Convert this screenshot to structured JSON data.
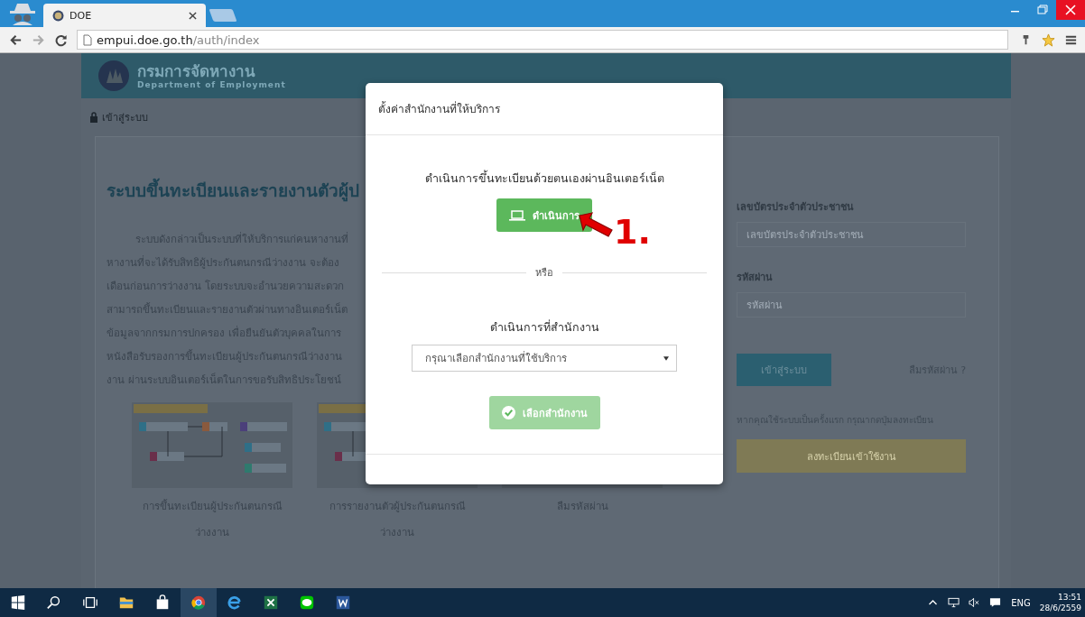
{
  "browser": {
    "tab_title": "DOE",
    "url_host": "empui.doe.go.th",
    "url_path": "/auth/index"
  },
  "site_header": {
    "title": "กรมการจัดหางาน",
    "subtitle": "Department of Employment"
  },
  "breadcrumb": "เข้าสู่ระบบ",
  "intro": {
    "title": "ระบบขึ้นทะเบียนและรายงานตัวผู้ป",
    "lines": [
      "ระบบดังกล่าวเป็นระบบที่ให้บริการแก่คนหางานที่",
      "หางานที่จะได้รับสิทธิผู้ประกันตนกรณีว่างงาน จะต้อง",
      "เดือนก่อนการว่างงาน โดยระบบจะอำนวยความสะดวก",
      "สามารถขึ้นทะเบียนและรายงานตัวผ่านทางอินเตอร์เน็ต",
      "ข้อมูลจากกรมการปกครอง เพื่อยืนยันตัวบุคคลในการ",
      "หนังสือรับรองการขึ้นทะเบียนผู้ประกันตนกรณีว่างงาน",
      "งาน ผ่านระบบอินเตอร์เน็ตในการขอรับสิทธิประโยชน์"
    ]
  },
  "guides": [
    {
      "caption": [
        "การขึ้นทะเบียนผู้ประกันตนกรณี",
        "ว่างงาน"
      ]
    },
    {
      "caption": [
        "การรายงานตัวผู้ประกันตนกรณี",
        "ว่างงาน"
      ]
    },
    {
      "caption": [
        "ลืมรหัสผ่าน"
      ]
    }
  ],
  "login": {
    "id_label": "เลขบัตรประจำตัวประชาชน",
    "id_placeholder": "เลขบัตรประจำตัวประชาชน",
    "password_label": "รหัสผ่าน",
    "password_placeholder": "รหัสผ่าน",
    "login_button": "เข้าสู่ระบบ",
    "forgot_link": "ลืมรหัสผ่าน ?",
    "first_time_note": "หากคุณใช้ระบบเป็นครั้งแรก กรุณากดปุ่มลงทะเบียน",
    "register_button": "ลงทะเบียนเข้าใช้งาน"
  },
  "modal": {
    "title": "ตั้งค่าสำนักงานที่ให้บริการ",
    "online_text": "ดำเนินการขึ้นทะเบียนด้วยตนเองผ่านอินเตอร์เน็ต",
    "online_button": "ดำเนินการ",
    "or_text": "หรือ",
    "office_label": "ดำเนินการที่สำนักงาน",
    "office_select": {
      "placeholder": "กรุณาเลือกสำนักงานที่ใช้บริการ"
    },
    "office_button": {
      "label": "เลือกสำนักงาน",
      "disabled": true
    }
  },
  "annotation": "1.",
  "taskbar": {
    "language": "ENG",
    "time": "13:51",
    "date": "28/6/2559"
  }
}
